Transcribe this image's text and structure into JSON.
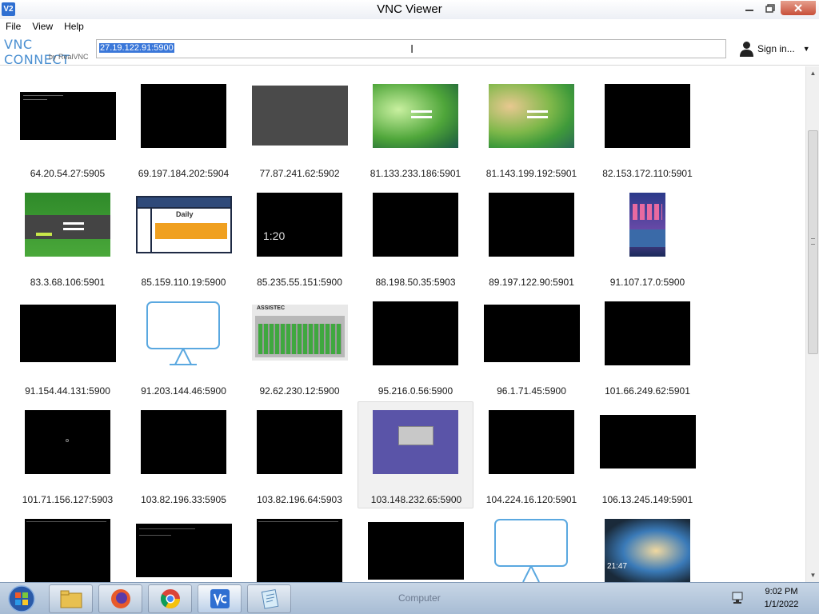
{
  "window": {
    "title": "VNC Viewer",
    "icon_text": "V2"
  },
  "menu": [
    "File",
    "View",
    "Help"
  ],
  "toolbar": {
    "logo_main": "VNC CONNECT",
    "logo_sub": "by RealVNC",
    "address_value": "27.19.122.91:5900",
    "signin_label": "Sign in..."
  },
  "connections": [
    {
      "label": "64.20.54.27:5905"
    },
    {
      "label": "69.197.184.202:5904"
    },
    {
      "label": "77.87.241.62:5902"
    },
    {
      "label": "81.133.233.186:5901"
    },
    {
      "label": "81.143.199.192:5901"
    },
    {
      "label": "82.153.172.110:5901"
    },
    {
      "label": "83.3.68.106:5901"
    },
    {
      "label": "85.159.110.19:5900",
      "thumb_text": "Daily"
    },
    {
      "label": "85.235.55.151:5900",
      "thumb_text": "1:20"
    },
    {
      "label": "88.198.50.35:5903"
    },
    {
      "label": "89.197.122.90:5901"
    },
    {
      "label": "91.107.17.0:5900"
    },
    {
      "label": "91.154.44.131:5900"
    },
    {
      "label": "91.203.144.46:5900"
    },
    {
      "label": "92.62.230.12:5900",
      "thumb_text": "ASSISTEC"
    },
    {
      "label": "95.216.0.56:5900"
    },
    {
      "label": "96.1.71.45:5900"
    },
    {
      "label": "101.66.249.62:5901"
    },
    {
      "label": "101.71.156.127:5903"
    },
    {
      "label": "103.82.196.33:5905"
    },
    {
      "label": "103.82.196.64:5903"
    },
    {
      "label": "103.148.232.65:5900"
    },
    {
      "label": "104.224.16.120:5901"
    },
    {
      "label": "106.13.245.149:5901"
    },
    {
      "label": ""
    },
    {
      "label": ""
    },
    {
      "label": ""
    },
    {
      "label": ""
    },
    {
      "label": ""
    },
    {
      "label": "",
      "thumb_text": "21:47"
    }
  ],
  "taskbar": {
    "time": "9:02 PM",
    "date": "1/1/2022",
    "ghost_label": "Computer"
  }
}
